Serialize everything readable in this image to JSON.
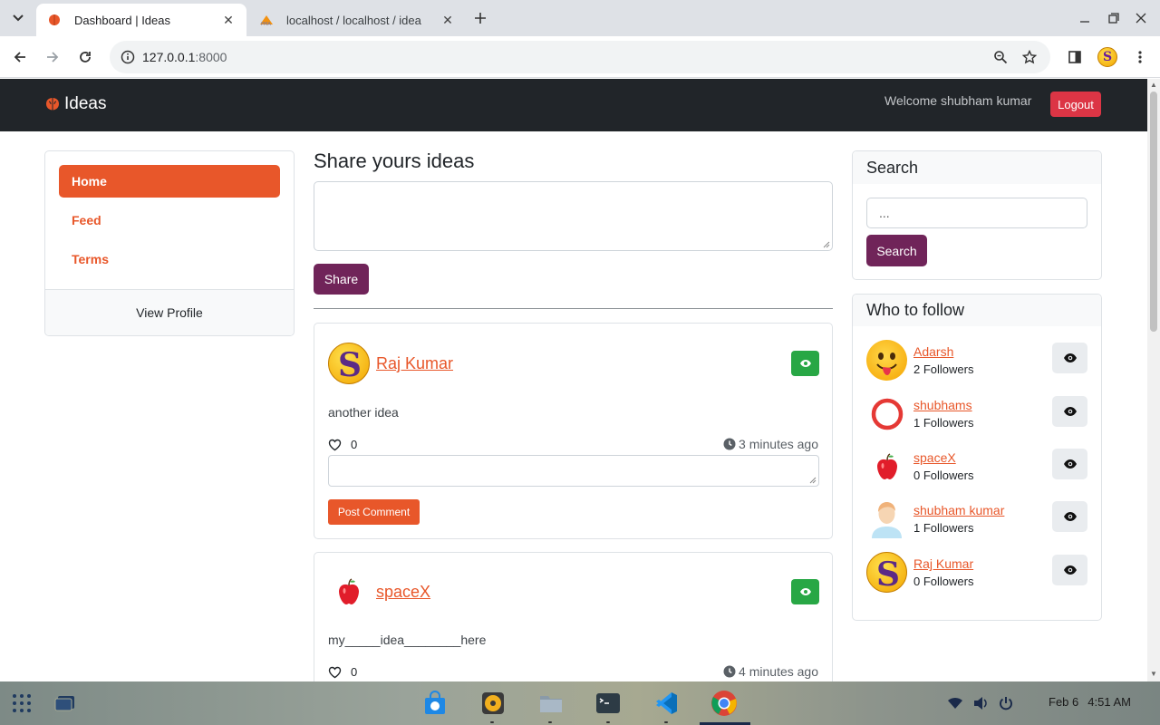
{
  "browser": {
    "tabs": [
      {
        "title": "Dashboard | Ideas",
        "active": true
      },
      {
        "title": "localhost / localhost / idea",
        "active": false
      }
    ],
    "url_host": "127.0.0.1",
    "url_port": ":8000"
  },
  "navbar": {
    "brand": "Ideas",
    "welcome": "Welcome shubham kumar",
    "logout_label": "Logout"
  },
  "sidebar": {
    "items": [
      {
        "label": "Home",
        "active": true
      },
      {
        "label": "Feed",
        "active": false
      },
      {
        "label": "Terms",
        "active": false
      }
    ],
    "footer_label": "View Profile"
  },
  "share": {
    "title": "Share yours ideas",
    "button_label": "Share"
  },
  "posts": [
    {
      "author": "Raj Kumar",
      "content": "another idea",
      "likes": "0",
      "time": "3 minutes ago",
      "comment_button": "Post Comment"
    },
    {
      "author": "spaceX",
      "content": "my_____idea________here",
      "likes": "0",
      "time": "4 minutes ago"
    }
  ],
  "search": {
    "title": "Search",
    "input_value": "...",
    "button_label": "Search"
  },
  "follow": {
    "title": "Who to follow",
    "people": [
      {
        "name": "Adarsh",
        "followers": "2 Followers"
      },
      {
        "name": "shubhams",
        "followers": "1 Followers"
      },
      {
        "name": "spaceX",
        "followers": "0 Followers"
      },
      {
        "name": "shubham kumar",
        "followers": "1 Followers"
      },
      {
        "name": "Raj Kumar",
        "followers": "0 Followers"
      }
    ]
  },
  "taskbar": {
    "date": "Feb 6",
    "time": "4:51 AM"
  },
  "colors": {
    "accent": "#e8572a",
    "primary_button": "#702459",
    "navbar": "#212529",
    "logout": "#dc3545",
    "view_button": "#28a745"
  }
}
